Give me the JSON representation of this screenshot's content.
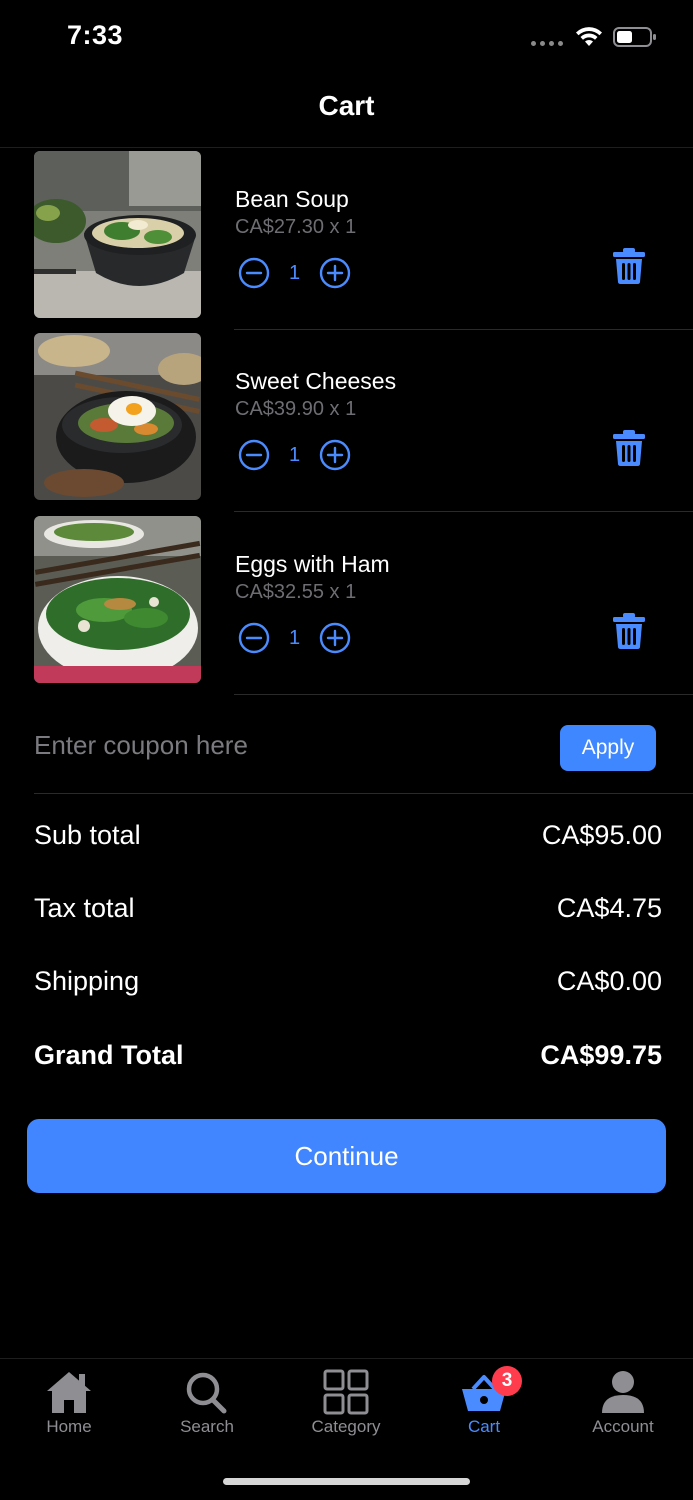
{
  "status_bar": {
    "time": "7:33"
  },
  "nav": {
    "title": "Cart"
  },
  "cart": {
    "items": [
      {
        "name": "Bean Soup",
        "price_line": "CA$27.30 x 1",
        "quantity": "1"
      },
      {
        "name": "Sweet Cheeses",
        "price_line": "CA$39.90 x 1",
        "quantity": "1"
      },
      {
        "name": "Eggs with Ham",
        "price_line": "CA$32.55 x 1",
        "quantity": "1"
      }
    ]
  },
  "coupon": {
    "placeholder": "Enter coupon here",
    "value": "",
    "apply_label": "Apply"
  },
  "summary": {
    "sub_total_label": "Sub total",
    "sub_total_value": "CA$95.00",
    "tax_total_label": "Tax total",
    "tax_total_value": "CA$4.75",
    "shipping_label": "Shipping",
    "shipping_value": "CA$0.00",
    "grand_total_label": "Grand Total",
    "grand_total_value": "CA$99.75"
  },
  "actions": {
    "continue_label": "Continue"
  },
  "tab_bar": {
    "tabs": [
      {
        "label": "Home",
        "icon": "home-icon",
        "active": false
      },
      {
        "label": "Search",
        "icon": "search-icon",
        "active": false
      },
      {
        "label": "Category",
        "icon": "grid-icon",
        "active": false
      },
      {
        "label": "Cart",
        "icon": "basket-icon",
        "active": true,
        "badge": "3"
      },
      {
        "label": "Account",
        "icon": "person-icon",
        "active": false
      }
    ]
  },
  "colors": {
    "accent": "#4286ff",
    "badge": "#ff3b4e",
    "background": "#000000",
    "muted_text": "#6d6d72"
  }
}
